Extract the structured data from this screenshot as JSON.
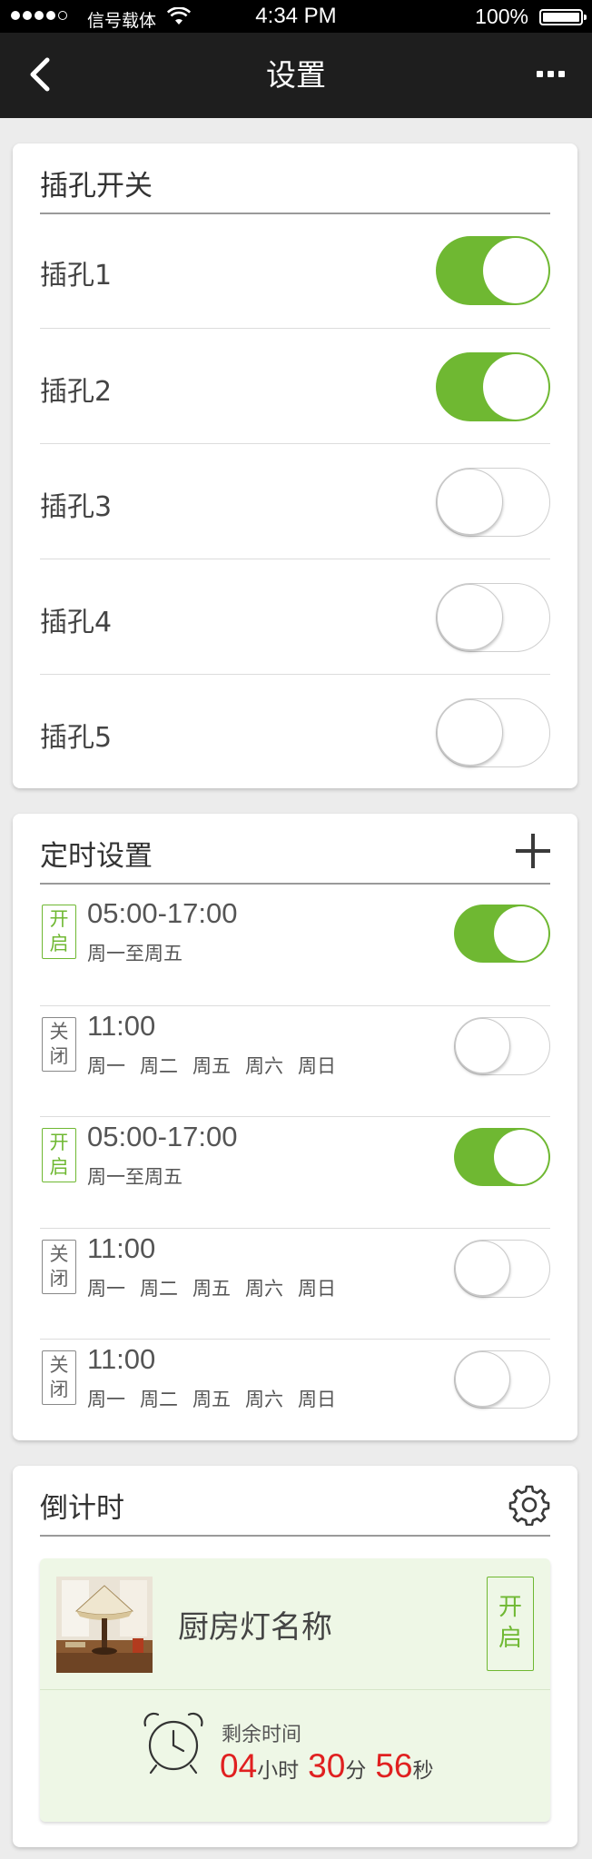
{
  "status_bar": {
    "carrier": "信号载体",
    "time": "4:34 PM",
    "battery": "100%"
  },
  "navbar": {
    "title": "设置"
  },
  "sockets": {
    "header": "插孔开关",
    "items": [
      {
        "label": "插孔1",
        "on": true
      },
      {
        "label": "插孔2",
        "on": true
      },
      {
        "label": "插孔3",
        "on": false
      },
      {
        "label": "插孔4",
        "on": false
      },
      {
        "label": "插孔5",
        "on": false
      }
    ]
  },
  "timers": {
    "header": "定时设置",
    "items": [
      {
        "tag": "开启",
        "time": "05:00-17:00",
        "days": [
          "周一至周五"
        ],
        "on": true
      },
      {
        "tag": "关闭",
        "time": "11:00",
        "days": [
          "周一",
          "周二",
          "周五",
          "周六",
          "周日"
        ],
        "on": false
      },
      {
        "tag": "开启",
        "time": "05:00-17:00",
        "days": [
          "周一至周五"
        ],
        "on": true
      },
      {
        "tag": "关闭",
        "time": "11:00",
        "days": [
          "周一",
          "周二",
          "周五",
          "周六",
          "周日"
        ],
        "on": false
      },
      {
        "tag": "关闭",
        "time": "11:00",
        "days": [
          "周一",
          "周二",
          "周五",
          "周六",
          "周日"
        ],
        "on": false
      }
    ]
  },
  "countdown": {
    "header": "倒计时",
    "device_name": "厨房灯名称",
    "status_button": "开启",
    "remaining_label": "剩余时间",
    "hours": "04",
    "hours_unit": "小时",
    "minutes": "30",
    "minutes_unit": "分",
    "seconds": "56",
    "seconds_unit": "秒"
  },
  "colors": {
    "accent_green": "#6fb832",
    "countdown_red": "#e02020",
    "navbar": "#1e1e1e"
  }
}
